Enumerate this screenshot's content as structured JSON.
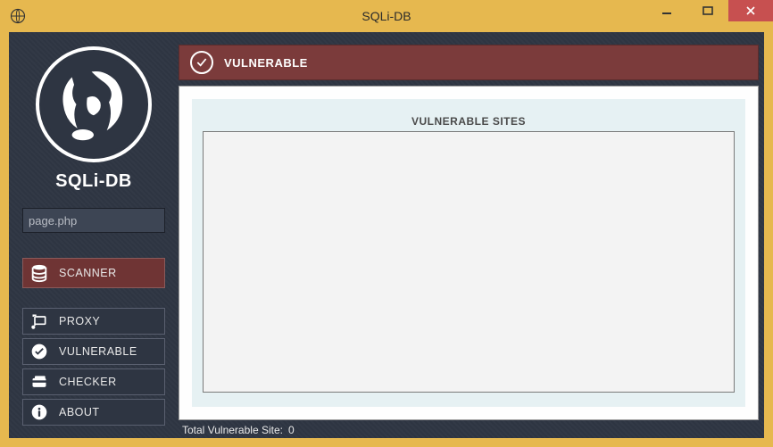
{
  "window": {
    "title": "SQLi-DB"
  },
  "sidebar": {
    "app_name": "SQLi-DB",
    "search": {
      "placeholder": "page.php",
      "value": ""
    },
    "nav_primary": {
      "label": "SCANNER"
    },
    "nav_items": [
      {
        "label": "PROXY"
      },
      {
        "label": "VULNERABLE"
      },
      {
        "label": "CHECKER"
      },
      {
        "label": "ABOUT"
      }
    ]
  },
  "main": {
    "header_label": "VULNERABLE",
    "panel_title": "VULNERABLE SITES",
    "sites": []
  },
  "status": {
    "label": "Total Vulnerable Site:",
    "count": "0"
  },
  "colors": {
    "frame": "#e6b84f",
    "client_bg": "#2e3542",
    "accent": "#7b3b3b",
    "close": "#c75050"
  }
}
